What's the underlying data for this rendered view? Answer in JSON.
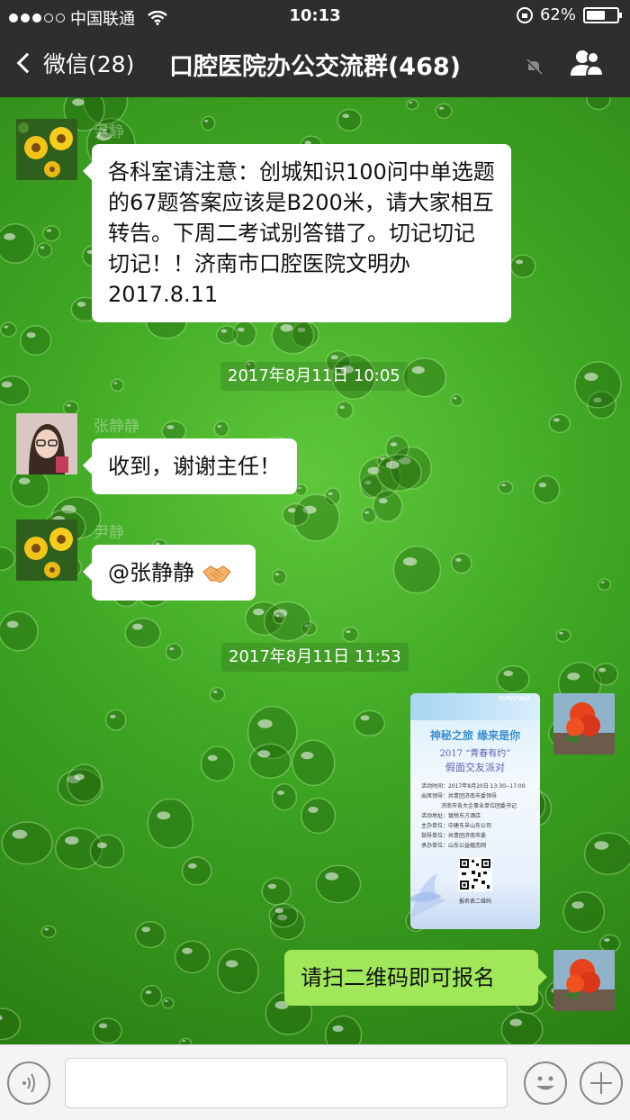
{
  "status_bar": {
    "carrier": "中国联通",
    "time": "10:13",
    "battery": "62%",
    "battery_level": 0.62
  },
  "header": {
    "back_label": "微信(28)",
    "title": "口腔医院办公交流群(468)"
  },
  "messages": {
    "m1_sender": "尹静",
    "m1_text": "各科室请注意：创城知识100问中单选题的67题答案应该是B200米，请大家相互转告。下周二考试别答错了。切记切记切记！！济南市口腔医院文明办2017.8.11",
    "time1": "2017年8月11日 10:05",
    "m2_sender": "张静静",
    "m2_text": "收到，谢谢主任！",
    "m3_sender": "尹静",
    "m3_text": "@张静静",
    "time2": "2017年8月11日 11:53",
    "m5_text": "请扫二维码即可报名"
  },
  "poster": {
    "tag": "SURNTALK",
    "line1": "神秘之旅 缘来是你",
    "line2": "2017 “青春有约”",
    "line3": "假面交友派对",
    "details": [
      "活动时间：2017年8月20日 13:30--17:00",
      "出席领导：共青团济南市委领导",
      "济南市各大企事业单位团委书记",
      "活动地址：银悦东方酒店",
      "主办单位：中建东孚山东公司",
      "指导单位：共青团济南市委",
      "承办单位：山东公益婚恋网"
    ],
    "qr_label": "报名表二维码"
  }
}
